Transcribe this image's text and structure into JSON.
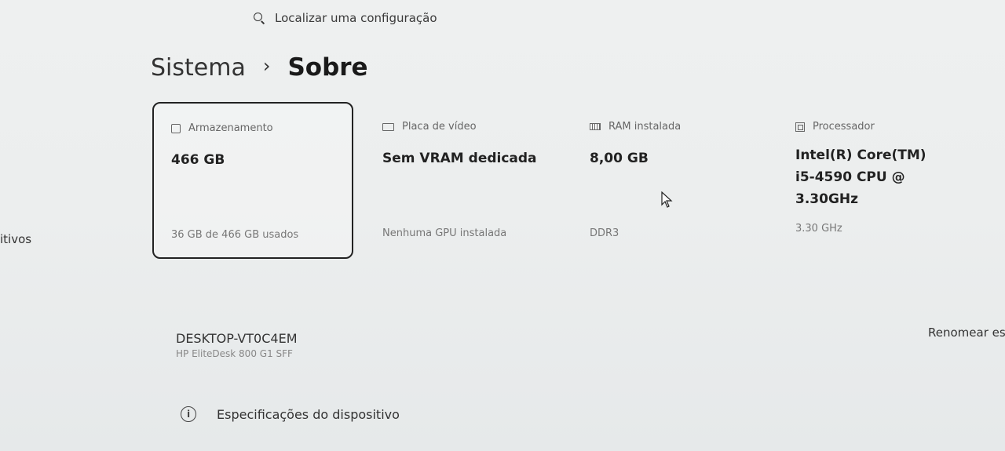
{
  "search": {
    "placeholder": "Localizar uma configuração",
    "icon": "search-icon"
  },
  "breadcrumb": {
    "parent": "Sistema",
    "separator": "›",
    "current": "Sobre"
  },
  "sidebar_fragment": "itivos",
  "specs_cards": [
    {
      "title": "Armazenamento",
      "value": "466 GB",
      "sub": "36 GB de 466 GB usados",
      "icon": "storage-icon",
      "selected": true
    },
    {
      "title": "Placa de vídeo",
      "value": "Sem VRAM dedicada",
      "sub": "Nenhuma GPU instalada",
      "icon": "gpu-icon"
    },
    {
      "title": "RAM instalada",
      "value": "8,00 GB",
      "sub": "DDR3",
      "icon": "ram-icon"
    },
    {
      "title": "Processador",
      "value": "Intel(R) Core(TM) i5-4590 CPU @ 3.30GHz",
      "sub": "3.30 GHz",
      "icon": "cpu-icon"
    }
  ],
  "device": {
    "name": "DESKTOP-VT0C4EM",
    "model": "HP EliteDesk 800 G1 SFF",
    "rename_label": "Renomear este"
  },
  "specs_link": {
    "label": "Especificações do dispositivo",
    "icon": "info-icon"
  }
}
